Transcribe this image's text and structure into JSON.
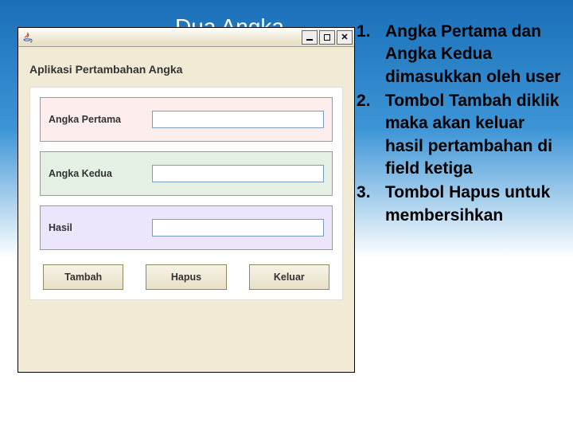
{
  "slide": {
    "title": "Dua Angka"
  },
  "window": {
    "min_label": "–",
    "max_label": "□",
    "close_label": "✕"
  },
  "app": {
    "title": "Aplikasi Pertambahan Angka",
    "field1_label": "Angka Pertama",
    "field2_label": "Angka Kedua",
    "field3_label": "Hasil",
    "btn_add": "Tambah",
    "btn_clear": "Hapus",
    "btn_exit": "Keluar"
  },
  "instructions": {
    "i1": "Angka Pertama dan Angka Kedua dimasukkan oleh user",
    "i2": "Tombol Tambah diklik maka akan keluar hasil pertambahan di field ketiga",
    "i3": "Tombol Hapus untuk membersihkan"
  }
}
